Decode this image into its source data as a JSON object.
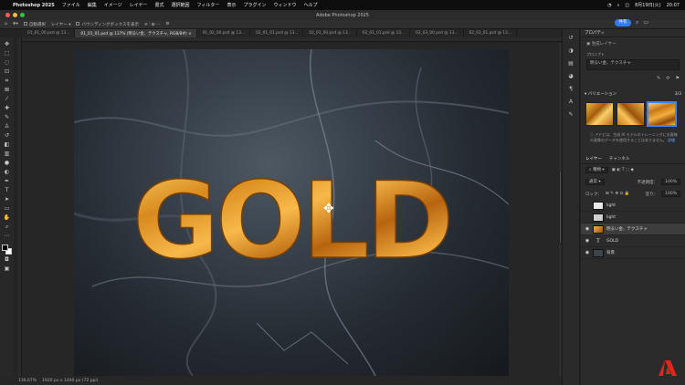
{
  "menubar": {
    "app_name": "Photoshop 2025",
    "items": [
      "ファイル",
      "編集",
      "イメージ",
      "レイヤー",
      "書式",
      "選択範囲",
      "フィルター",
      "表示",
      "プラグイン",
      "ウィンドウ",
      "ヘルプ"
    ],
    "date": "8月19日(火)",
    "time": "20:07"
  },
  "window": {
    "title": "Adobe Photoshop 2025"
  },
  "options_bar": {
    "auto_select_label": "自動選択",
    "layer_dropdown": "レイヤー",
    "bbox_label": "バウンディングボックスを表示",
    "share_label": "共有"
  },
  "tabs": [
    {
      "label": "01_01_00.psd @ 13...",
      "active": false
    },
    {
      "label": "01_01_01.psd @ 137% (明るい金、テクスチャ, RGB/8#) ×",
      "active": true
    },
    {
      "label": "01_02_00.psd @ 13...",
      "active": false
    },
    {
      "label": "02_01_01.psd @ 13...",
      "active": false
    },
    {
      "label": "02_01_00.psd @ 13...",
      "active": false
    },
    {
      "label": "02_01_01.psd @ 13...",
      "active": false
    },
    {
      "label": "02_03_00.psd @ 13...",
      "active": false
    },
    {
      "label": "02_03_01.psd @ 13...",
      "active": false
    }
  ],
  "canvas": {
    "headline": "GOLD"
  },
  "status": {
    "zoom": "136.67%",
    "doc_info": "1920 px x 1440 px (72 ppi)"
  },
  "properties": {
    "title": "プロパティ",
    "subtitle": "生成レイヤー",
    "prompt_label": "プロンプト",
    "prompt_value": "明るい金、テクスチャ"
  },
  "variations": {
    "title": "バリエーション",
    "count": "3/3"
  },
  "variation_note": {
    "text": "アドビは、生成 AI モデルのトレーニングにお客様の画像のデータを使用することはありません。",
    "link": "詳細"
  },
  "layers_panel": {
    "tabs": [
      "レイヤー",
      "チャンネル"
    ],
    "filter_label": "種類",
    "blend_mode": "通常",
    "opacity_label": "不透明度：",
    "opacity_value": "100%",
    "lock_label": "ロック：",
    "fill_label": "塗り：",
    "fill_value": "100%",
    "layers": [
      {
        "name": "light",
        "type": "image",
        "visible": false,
        "selected": false
      },
      {
        "name": "light",
        "type": "image",
        "visible": false,
        "selected": false
      },
      {
        "name": "明るい金、テクスチャ",
        "type": "generative",
        "visible": true,
        "selected": true
      },
      {
        "name": "GOLD",
        "type": "text",
        "visible": true,
        "selected": false
      },
      {
        "name": "背景",
        "type": "image",
        "visible": true,
        "selected": false
      }
    ]
  },
  "colors": {
    "gold_light": "#f4b342",
    "gold_dark": "#b8640f",
    "accent_blue": "#3579f6",
    "adobe_red": "#e1251b"
  }
}
